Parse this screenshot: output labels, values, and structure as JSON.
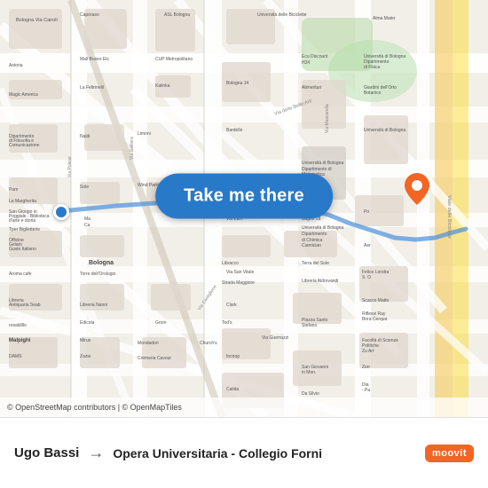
{
  "map": {
    "background_color": "#f2efe9",
    "attribution": "© OpenStreetMap contributors | © OpenMapTiles"
  },
  "button": {
    "label": "Take me there"
  },
  "bottom_bar": {
    "origin": "Ugo Bassi",
    "arrow": "→",
    "destination": "Opera Universitaria - Collegio Forni"
  },
  "moovit": {
    "label": "moovit"
  },
  "markers": {
    "origin_color": "#2979c9",
    "destination_color": "#f26522"
  }
}
